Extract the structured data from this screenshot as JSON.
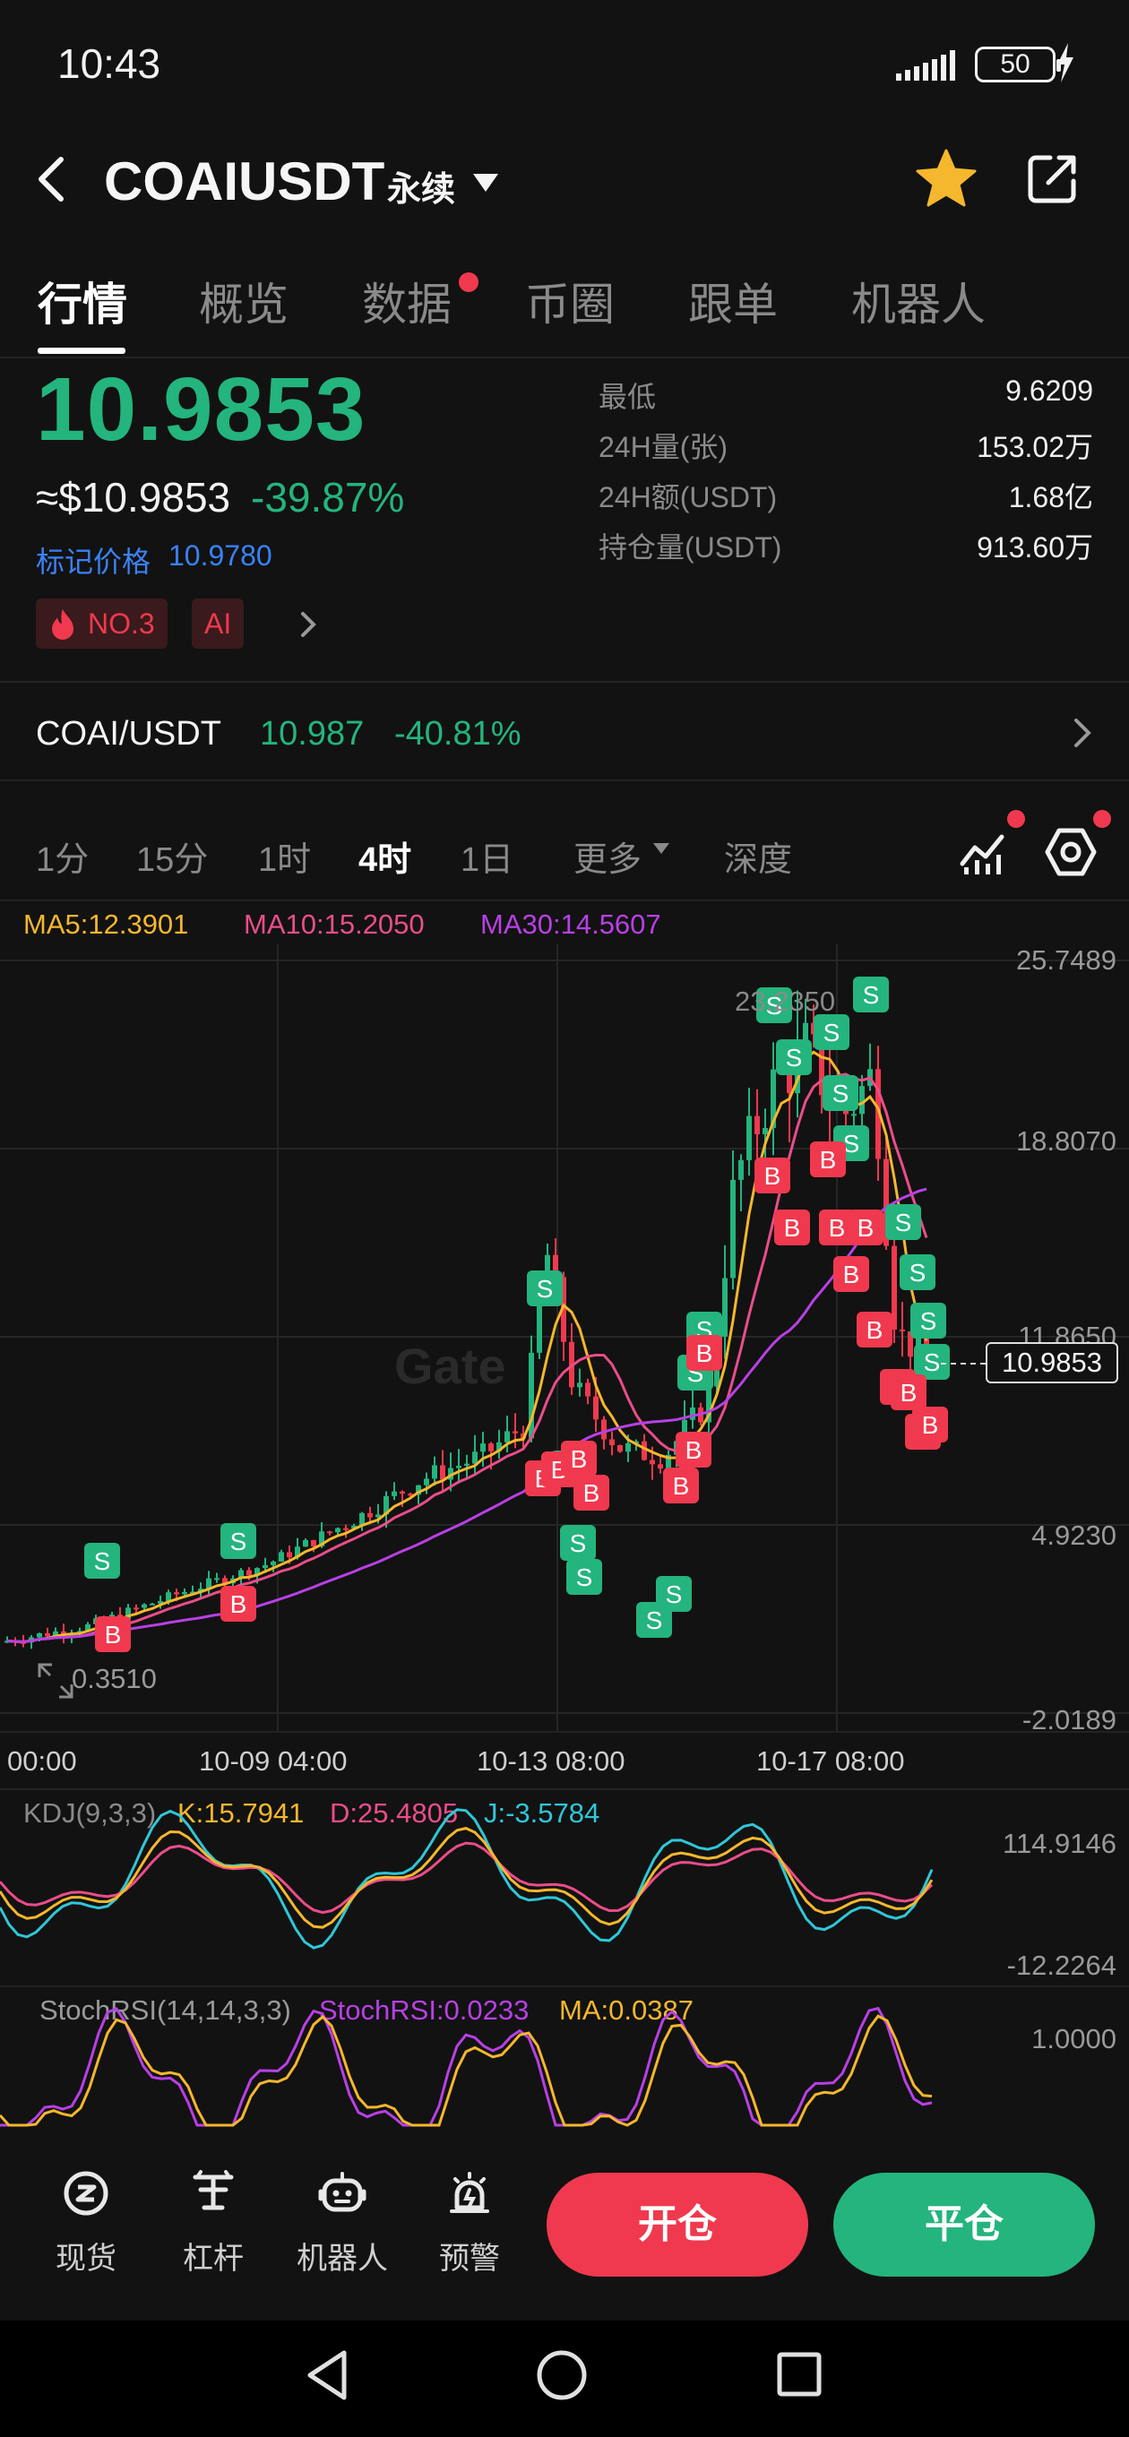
{
  "status_bar": {
    "time": "10:43",
    "battery": "50"
  },
  "header": {
    "pair": "COAIUSDT",
    "contract_type": "永续"
  },
  "tabs": [
    {
      "label": "行情"
    },
    {
      "label": "概览"
    },
    {
      "label": "数据"
    },
    {
      "label": "币圈"
    },
    {
      "label": "跟单"
    },
    {
      "label": "机器人"
    }
  ],
  "ticker": {
    "last_price": "10.9853",
    "usd_price": "≈$10.9853",
    "change_pct": "-39.87%",
    "mark_label": "标记价格",
    "mark_price": "10.9780",
    "rank_badge": "NO.3",
    "tag_badge": "AI"
  },
  "stats": [
    {
      "label": "最低",
      "value": "9.6209"
    },
    {
      "label": "24H量(张)",
      "value": "153.02万"
    },
    {
      "label": "24H额(USDT)",
      "value": "1.68亿"
    },
    {
      "label": "持仓量(USDT)",
      "value": "913.60万"
    }
  ],
  "spot": {
    "pair": "COAI/USDT",
    "price": "10.987",
    "change": "-40.81%"
  },
  "timeframes": [
    {
      "label": "1分"
    },
    {
      "label": "15分"
    },
    {
      "label": "1时"
    },
    {
      "label": "4时"
    },
    {
      "label": "1日"
    },
    {
      "label": "更多"
    },
    {
      "label": "深度"
    }
  ],
  "ma_legend": {
    "ma5": "MA5:12.3901",
    "ma10": "MA10:15.2050",
    "ma30": "MA30:14.5607"
  },
  "chart": {
    "y_axis": [
      "25.7489",
      "18.8070",
      "11.8650",
      "4.9230",
      "-2.0189"
    ],
    "x_axis": [
      "00:00",
      "10-09 04:00",
      "10-13 08:00",
      "10-17 08:00"
    ],
    "current_price": "10.9853",
    "high_annotation": "23.2350",
    "low_annotation": "0.3510",
    "watermark": "Gate"
  },
  "chart_data": {
    "type": "candlestick",
    "x": [
      "00:00",
      "10-09 04:00",
      "10-13 08:00",
      "10-17 08:00"
    ],
    "y_ticks": [
      25.7489,
      18.807,
      11.865,
      4.923,
      -2.0189
    ],
    "ylim": [
      -2.0189,
      25.7489
    ],
    "current_price": 10.9853,
    "max_label": 23.235,
    "min_label": 0.351,
    "ma": {
      "MA5": 12.3901,
      "MA10": 15.205,
      "MA30": 14.5607
    },
    "colors": {
      "up": "#24b47e",
      "down": "#f0394e",
      "ma5": "#f5b72d",
      "ma10": "#ea4d8a",
      "ma30": "#b840e6"
    }
  },
  "kdj": {
    "title": "KDJ(9,3,3)",
    "k": "K:15.7941",
    "d": "D:25.4805",
    "j": "J:-3.5784",
    "y_axis": [
      "114.9146",
      "-12.2264"
    ]
  },
  "stochrsi": {
    "title": "StochRSI(14,14,3,3)",
    "value": "StochRSI:0.0233",
    "ma": "MA:0.0387",
    "y_axis": [
      "1.0000"
    ]
  },
  "bottom_nav": [
    {
      "label": "现货"
    },
    {
      "label": "杠杆"
    },
    {
      "label": "机器人"
    },
    {
      "label": "预警"
    }
  ],
  "actions": {
    "open": "开仓",
    "close": "平仓"
  },
  "colors": {
    "up": "#24b47e",
    "down": "#f0394e",
    "link": "#3a82f6",
    "background": "#121212"
  }
}
